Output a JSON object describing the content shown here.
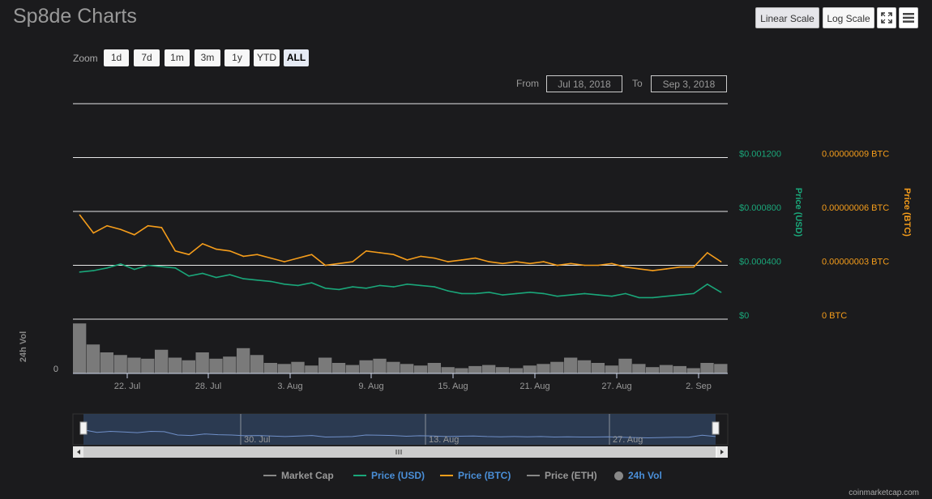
{
  "header": {
    "title": "Sp8de Charts"
  },
  "toolbar": {
    "linear_label": "Linear Scale",
    "log_label": "Log Scale",
    "active_scale": "linear"
  },
  "zoom": {
    "label": "Zoom",
    "buttons": [
      "1d",
      "7d",
      "1m",
      "3m",
      "1y",
      "YTD",
      "ALL"
    ],
    "active": "ALL"
  },
  "range": {
    "from_label": "From",
    "from_value": "Jul 18, 2018",
    "to_label": "To",
    "to_value": "Sep 3, 2018"
  },
  "legend": {
    "market_cap": "Market Cap",
    "price_usd": "Price (USD)",
    "price_btc": "Price (BTC)",
    "price_eth": "Price (ETH)",
    "vol": "24h Vol"
  },
  "credit": "coinmarketcap.com",
  "colors": {
    "usd": "#1aa77a",
    "btc": "#f59d1b",
    "vol": "#7a7a7a",
    "navigator_fill": "#2e3e58",
    "navigator_line": "#6f8fc8"
  },
  "chart_data": {
    "type": "line",
    "x_ticks": [
      "22. Jul",
      "28. Jul",
      "3. Aug",
      "9. Aug",
      "15. Aug",
      "21. Aug",
      "27. Aug",
      "2. Sep"
    ],
    "y_left": {
      "label": "Price (USD)",
      "ticks": [
        "$0",
        "$0.000400",
        "$0.000800",
        "$0.001200"
      ],
      "range": [
        0,
        0.0016
      ]
    },
    "y_right": {
      "label": "Price (BTC)",
      "ticks": [
        "0 BTC",
        "0.00000003 BTC",
        "0.00000006 BTC",
        "0.00000009 BTC"
      ],
      "range": [
        0,
        1.2e-07
      ]
    },
    "vol_axis": {
      "label": "24h Vol",
      "ticks": [
        "0"
      ]
    },
    "x": [
      "2018-07-18",
      "2018-07-19",
      "2018-07-20",
      "2018-07-21",
      "2018-07-22",
      "2018-07-23",
      "2018-07-24",
      "2018-07-25",
      "2018-07-26",
      "2018-07-27",
      "2018-07-28",
      "2018-07-29",
      "2018-07-30",
      "2018-07-31",
      "2018-08-01",
      "2018-08-02",
      "2018-08-03",
      "2018-08-04",
      "2018-08-05",
      "2018-08-06",
      "2018-08-07",
      "2018-08-08",
      "2018-08-09",
      "2018-08-10",
      "2018-08-11",
      "2018-08-12",
      "2018-08-13",
      "2018-08-14",
      "2018-08-15",
      "2018-08-16",
      "2018-08-17",
      "2018-08-18",
      "2018-08-19",
      "2018-08-20",
      "2018-08-21",
      "2018-08-22",
      "2018-08-23",
      "2018-08-24",
      "2018-08-25",
      "2018-08-26",
      "2018-08-27",
      "2018-08-28",
      "2018-08-29",
      "2018-08-30",
      "2018-08-31",
      "2018-09-01",
      "2018-09-02",
      "2018-09-03"
    ],
    "series": [
      {
        "name": "Price (USD)",
        "axis": "left",
        "values": [
          0.00035,
          0.00036,
          0.00038,
          0.00041,
          0.00037,
          0.0004,
          0.00039,
          0.00038,
          0.00032,
          0.00034,
          0.00031,
          0.00033,
          0.0003,
          0.00029,
          0.00028,
          0.00026,
          0.00025,
          0.00027,
          0.00023,
          0.00022,
          0.00024,
          0.00023,
          0.00025,
          0.00024,
          0.00026,
          0.00025,
          0.00024,
          0.00021,
          0.00019,
          0.00019,
          0.0002,
          0.00018,
          0.00019,
          0.0002,
          0.00019,
          0.00017,
          0.00018,
          0.00019,
          0.00018,
          0.00017,
          0.00019,
          0.00016,
          0.00016,
          0.00017,
          0.00018,
          0.00019,
          0.00026,
          0.0002
        ]
      },
      {
        "name": "Price (BTC)",
        "axis": "right",
        "values": [
          5.8e-08,
          4.8e-08,
          5.2e-08,
          5e-08,
          4.7e-08,
          5.2e-08,
          5.1e-08,
          3.8e-08,
          3.6e-08,
          4.2e-08,
          3.9e-08,
          3.8e-08,
          3.5e-08,
          3.6e-08,
          3.4e-08,
          3.2e-08,
          3.4e-08,
          3.6e-08,
          3e-08,
          3.1e-08,
          3.2e-08,
          3.8e-08,
          3.7e-08,
          3.6e-08,
          3.3e-08,
          3.5e-08,
          3.4e-08,
          3.2e-08,
          3.3e-08,
          3.4e-08,
          3.2e-08,
          3.1e-08,
          3.2e-08,
          3.1e-08,
          3.2e-08,
          3e-08,
          3.1e-08,
          3e-08,
          3e-08,
          3.1e-08,
          2.9e-08,
          2.8e-08,
          2.7e-08,
          2.8e-08,
          2.9e-08,
          2.9e-08,
          3.7e-08,
          3.2e-08
        ]
      },
      {
        "name": "24h Vol",
        "axis": "vol",
        "values": [
          95,
          55,
          40,
          35,
          30,
          28,
          45,
          30,
          25,
          40,
          28,
          32,
          48,
          35,
          20,
          18,
          22,
          15,
          30,
          20,
          16,
          25,
          28,
          22,
          18,
          15,
          20,
          12,
          10,
          14,
          16,
          12,
          10,
          15,
          18,
          22,
          30,
          25,
          20,
          15,
          28,
          18,
          12,
          16,
          14,
          10,
          20,
          18
        ]
      }
    ],
    "grid": true,
    "legend_position": "bottom"
  }
}
